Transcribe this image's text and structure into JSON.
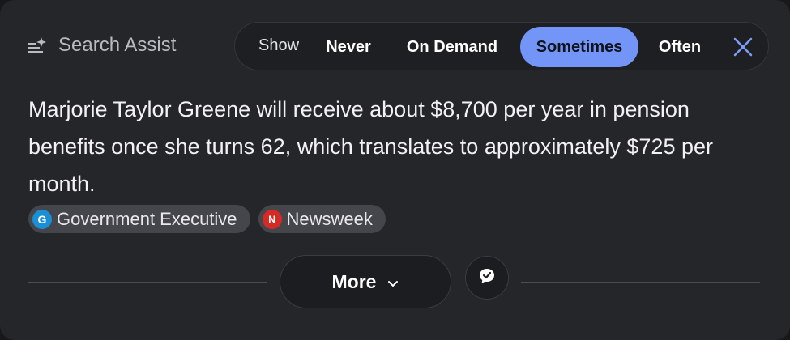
{
  "header": {
    "title": "Search Assist",
    "icon": "sparkle-lines-icon"
  },
  "toolbar": {
    "show_label": "Show",
    "options": [
      {
        "label": "Never",
        "selected": false
      },
      {
        "label": "On Demand",
        "selected": false
      },
      {
        "label": "Sometimes",
        "selected": true
      },
      {
        "label": "Often",
        "selected": false
      }
    ],
    "close_icon": "close-icon"
  },
  "answer": {
    "text": "Marjorie Taylor Greene will receive about $8,700 per year in pension benefits once she turns 62, which translates to approximately $725 per month."
  },
  "sources": [
    {
      "name": "Government Executive",
      "icon_letter": "G"
    },
    {
      "name": "Newsweek",
      "icon_letter": "N"
    }
  ],
  "footer": {
    "more_label": "More",
    "more_icon": "chevron-down-icon",
    "feedback_icon": "feedback-bubble-icon"
  },
  "colors": {
    "accent": "#7295f7",
    "background": "#252629",
    "close": "#7b9df8"
  }
}
